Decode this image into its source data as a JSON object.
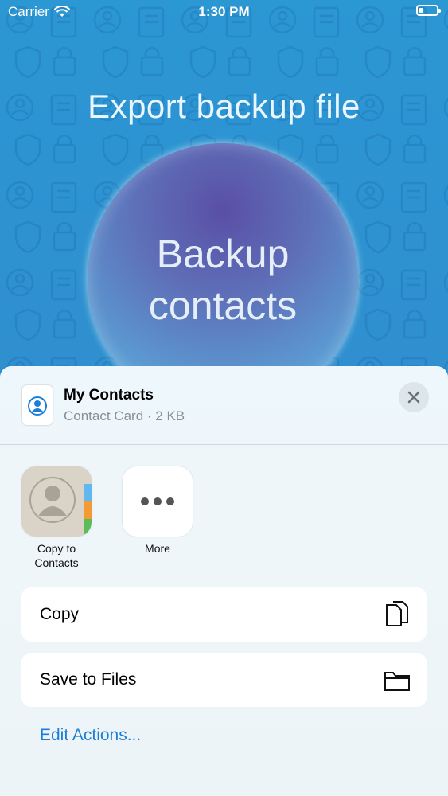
{
  "status_bar": {
    "carrier": "Carrier",
    "time": "1:30 PM"
  },
  "background": {
    "title": "Export backup file",
    "circle_line1": "Backup",
    "circle_line2": "contacts"
  },
  "share_sheet": {
    "file_name": "My Contacts",
    "file_meta": "Contact Card · 2 KB",
    "apps": [
      {
        "label": "Copy to\nContacts",
        "icon": "contacts-app-icon"
      },
      {
        "label": "More",
        "icon": "more-icon"
      }
    ],
    "actions": [
      {
        "label": "Copy",
        "icon": "copy-icon"
      },
      {
        "label": "Save to Files",
        "icon": "folder-icon"
      }
    ],
    "edit_actions": "Edit Actions..."
  },
  "colors": {
    "accent": "#1a7ed6",
    "background": "#2b97d3"
  }
}
